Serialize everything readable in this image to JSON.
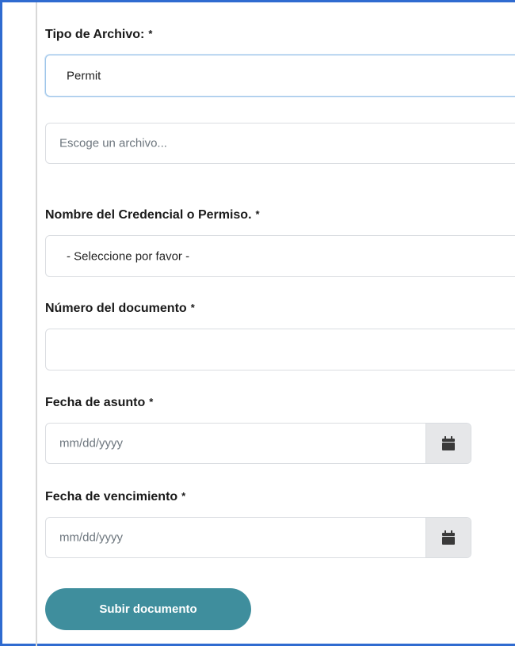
{
  "form": {
    "file_type": {
      "label": "Tipo de Archivo:",
      "required_mark": "*",
      "value": "Permit"
    },
    "file_picker": {
      "placeholder": "Escoge un archivo..."
    },
    "credential_name": {
      "label": "Nombre del Credencial o Permiso.",
      "required_mark": "*",
      "selected": "- Seleccione por favor -"
    },
    "document_number": {
      "label": "Número del documento",
      "required_mark": "*",
      "value": ""
    },
    "issue_date": {
      "label": "Fecha de asunto",
      "required_mark": "*",
      "placeholder": "mm/dd/yyyy",
      "icon": "calendar-icon"
    },
    "expiration_date": {
      "label": "Fecha de vencimiento",
      "required_mark": "*",
      "placeholder": "mm/dd/yyyy",
      "icon": "calendar-icon"
    },
    "submit_label": "Subir documento"
  },
  "colors": {
    "frame_border": "#2f6bd0",
    "submit_bg": "#3f8e9d",
    "focus_border": "#9fc6e9"
  }
}
